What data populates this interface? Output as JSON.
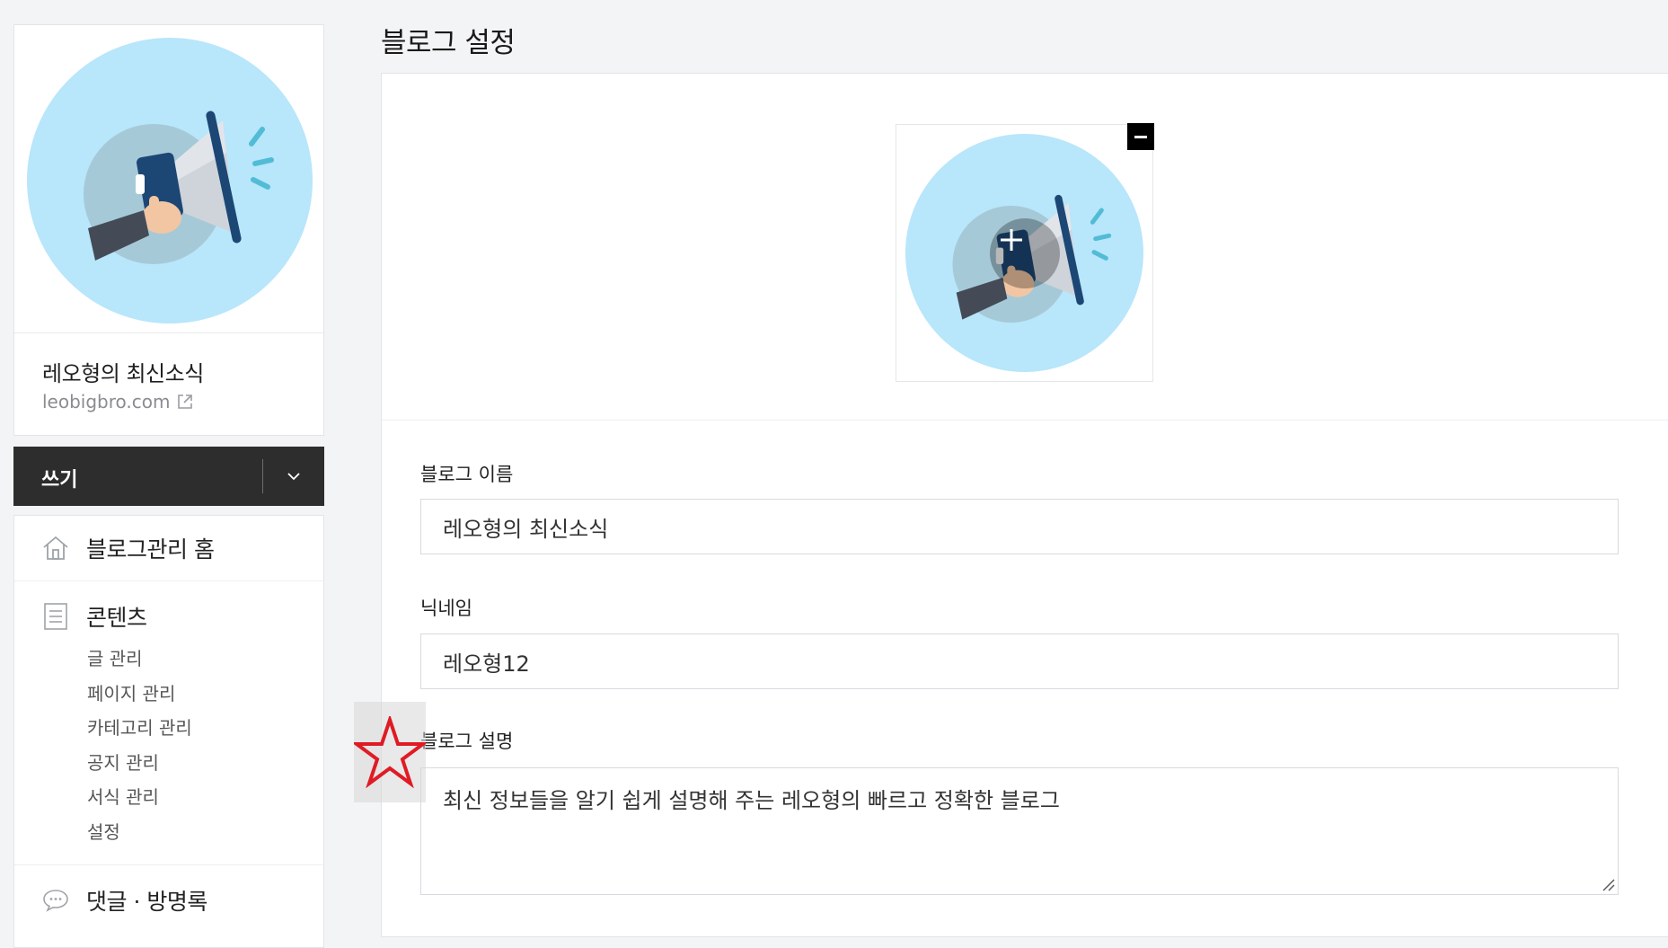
{
  "sidebar": {
    "blog_name": "레오형의 최신소식",
    "blog_url": "leobigbro.com",
    "write_button": "쓰기",
    "menu": {
      "home": "블로그관리 홈",
      "content": {
        "title": "콘텐츠",
        "items": [
          "글 관리",
          "페이지 관리",
          "카테고리 관리",
          "공지 관리",
          "서식 관리",
          "설정"
        ]
      },
      "comments": "댓글 · 방명록"
    }
  },
  "main": {
    "title": "블로그 설정",
    "fields": {
      "blog_name": {
        "label": "블로그 이름",
        "value": "레오형의 최신소식"
      },
      "nickname": {
        "label": "닉네임",
        "value": "레오형12"
      },
      "description": {
        "label": "블로그 설명",
        "value": "최신 정보들을 알기 쉽게 설명해 주는 레오형의 빠르고 정확한 블로그"
      }
    }
  },
  "icons": {
    "home": "home-icon",
    "content": "document-icon",
    "comments": "speech-bubble-icon",
    "external_link": "external-link-icon",
    "dropdown": "chevron-down-icon",
    "remove": "minus-icon",
    "add": "plus-icon",
    "annotation": "star-icon"
  },
  "colors": {
    "write_button_bg": "#2d2d2d",
    "profile_circle": "#b8e6fb",
    "star_annotation": "#e01b24"
  }
}
